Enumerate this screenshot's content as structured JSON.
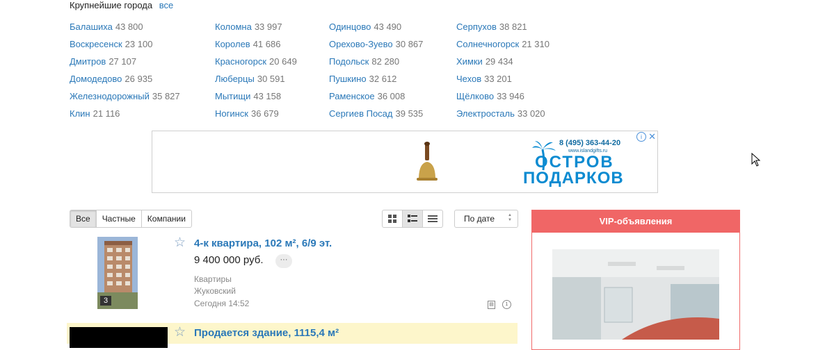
{
  "cities_header": {
    "title": "Крупнейшие города",
    "all_link": "все"
  },
  "cities": {
    "col1": [
      {
        "name": "Балашиха",
        "count": "43 800"
      },
      {
        "name": "Воскресенск",
        "count": "23 100"
      },
      {
        "name": "Дмитров",
        "count": "27 107"
      },
      {
        "name": "Домодедово",
        "count": "26 935"
      },
      {
        "name": "Железнодорожный",
        "count": "35 827"
      },
      {
        "name": "Клин",
        "count": "21 116"
      }
    ],
    "col2": [
      {
        "name": "Коломна",
        "count": "33 997"
      },
      {
        "name": "Королев",
        "count": "41 686"
      },
      {
        "name": "Красногорск",
        "count": "20 649"
      },
      {
        "name": "Люберцы",
        "count": "30 591"
      },
      {
        "name": "Мытищи",
        "count": "43 158"
      },
      {
        "name": "Ногинск",
        "count": "36 679"
      }
    ],
    "col3": [
      {
        "name": "Одинцово",
        "count": "43 490"
      },
      {
        "name": "Орехово-Зуево",
        "count": "30 867"
      },
      {
        "name": "Подольск",
        "count": "82 280"
      },
      {
        "name": "Пушкино",
        "count": "32 612"
      },
      {
        "name": "Раменское",
        "count": "36 008"
      },
      {
        "name": "Сергиев Посад",
        "count": "39 535"
      }
    ],
    "col4": [
      {
        "name": "Серпухов",
        "count": "38 821"
      },
      {
        "name": "Солнечногорск",
        "count": "21 310"
      },
      {
        "name": "Химки",
        "count": "29 434"
      },
      {
        "name": "Чехов",
        "count": "33 201"
      },
      {
        "name": "Щёлково",
        "count": "33 946"
      },
      {
        "name": "Электросталь",
        "count": "33 020"
      }
    ]
  },
  "ad": {
    "phone": "8 (495) 363-44-20",
    "site": "www.islandgifts.ru",
    "brand_line1": "ОСТРОВ",
    "brand_line2": "ПОДАРКОВ",
    "info_icon": "info-icon",
    "close_icon": "close-icon"
  },
  "filters": {
    "all": "Все",
    "private": "Частные",
    "companies": "Компании"
  },
  "views": {
    "grid": "grid-view-icon",
    "list": "list-view-icon",
    "compact": "compact-view-icon"
  },
  "sort": {
    "value": "По дате"
  },
  "listings": [
    {
      "title": "4-к квартира, 102 м², 6/9 эт.",
      "price": "9 400 000 руб.",
      "more": "···",
      "category": "Квартиры",
      "city": "Жуковский",
      "date": "Сегодня 14:52",
      "photo_count": "3"
    },
    {
      "title": "Продается здание, 1115,4 м²"
    }
  ],
  "vip": {
    "title": "VIP-объявления"
  }
}
